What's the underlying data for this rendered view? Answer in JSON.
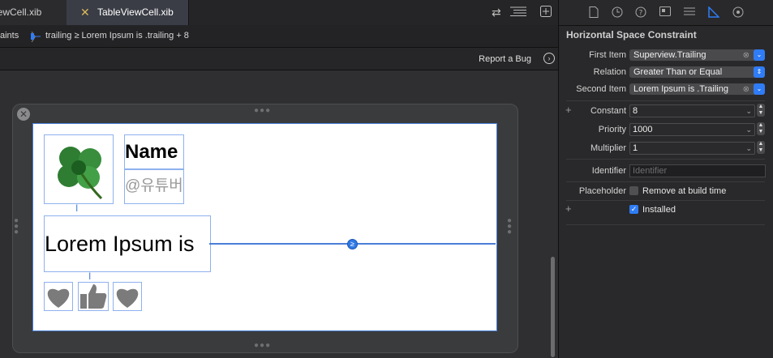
{
  "tabs": [
    {
      "label": "iewCell.xib",
      "active": false
    },
    {
      "label": "TableViewCell.xib",
      "active": true
    }
  ],
  "toolbar_icons": [
    "swap-icon",
    "list-lines-icon",
    "add-editor-icon"
  ],
  "jumpbar": {
    "crumb1": "aints",
    "crumb2": "trailing ≥ Lorem Ipsum is .trailing + 8"
  },
  "bugbar": {
    "label": "Report a Bug"
  },
  "canvas": {
    "name_label": "Name",
    "handle_label": "@유튜버",
    "lorem_label": "Lorem Ipsum is"
  },
  "inspector": {
    "title": "Horizontal Space Constraint",
    "first_item": {
      "label": "First Item",
      "value": "Superview.Trailing"
    },
    "relation": {
      "label": "Relation",
      "value": "Greater Than or Equal"
    },
    "second_item": {
      "label": "Second Item",
      "value": "Lorem Ipsum is .Trailing"
    },
    "constant": {
      "label": "Constant",
      "value": "8"
    },
    "priority": {
      "label": "Priority",
      "value": "1000"
    },
    "multiplier": {
      "label": "Multiplier",
      "value": "1"
    },
    "identifier": {
      "label": "Identifier",
      "placeholder": "Identifier"
    },
    "placeholder": {
      "label": "Placeholder",
      "checkbox_label": "Remove at build time",
      "checked": false
    },
    "installed": {
      "checkbox_label": "Installed",
      "checked": true
    }
  },
  "colors": {
    "accent": "#2f7cf6",
    "canvas_bg": "#2f2f31",
    "inspector_bg": "#29292b"
  }
}
